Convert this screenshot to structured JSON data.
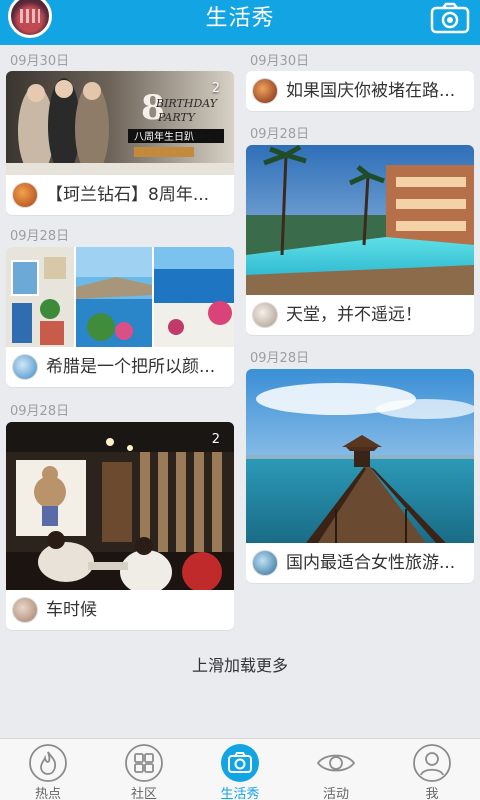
{
  "header": {
    "title": "生活秀",
    "left_icon": "user-avatar",
    "right_icon": "camera-icon"
  },
  "left_column": [
    {
      "date": "09月30日",
      "badge": "2",
      "title": "【珂兰钻石】8周年...",
      "image": "kela-8th-anniversary-birthday-party"
    },
    {
      "date": "09月28日",
      "title": "希腊是一个把所以颜...",
      "image": "greece-photo-collage"
    },
    {
      "date": "09月28日",
      "badge": "2",
      "title": "车时候",
      "image": "restaurant-interior"
    }
  ],
  "right_column": [
    {
      "date": "09月30日",
      "title": "如果国庆你被堵在路..."
    },
    {
      "date": "09月28日",
      "title": "天堂，并不遥远！",
      "image": "tropical-resort-pool"
    },
    {
      "date": "09月28日",
      "title": "国内最适合女性旅游...",
      "image": "sea-pier-pavilion"
    }
  ],
  "load_more": "上滑加载更多",
  "tabs": [
    {
      "label": "热点",
      "icon": "flame-icon"
    },
    {
      "label": "社区",
      "icon": "grid-icon"
    },
    {
      "label": "生活秀",
      "icon": "camera-icon",
      "active": true
    },
    {
      "label": "活动",
      "icon": "eye-icon"
    },
    {
      "label": "我",
      "icon": "person-icon"
    }
  ],
  "colors": {
    "accent": "#13a4e3",
    "background": "#e9ebee",
    "text": "#333333",
    "date": "#9a9ea4"
  }
}
